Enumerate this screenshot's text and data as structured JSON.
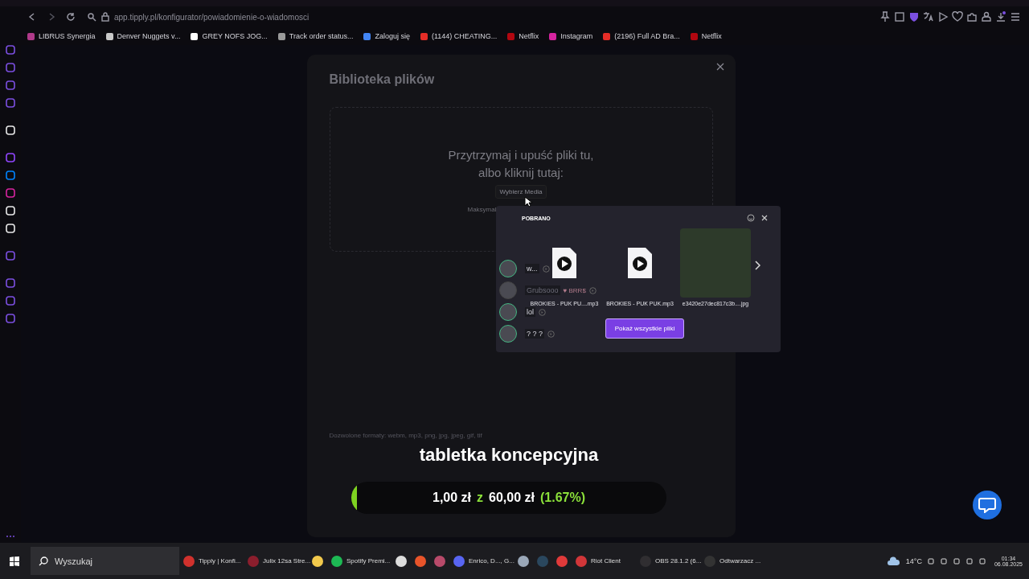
{
  "browser": {
    "address": "app.tipply.pl/konfigurator/powiadomienie-o-wiadomosci",
    "bookmarks": [
      {
        "label": "LIBRUS Synergia",
        "color": "#b03a8a"
      },
      {
        "label": "Denver Nuggets v...",
        "color": "#c9c9c9"
      },
      {
        "label": "GREY NOFS JOG...",
        "color": "#ffffff"
      },
      {
        "label": "Track order status...",
        "color": "#9a9a9a"
      },
      {
        "label": "Zaloguj się",
        "color": "#4285f4"
      },
      {
        "label": "(1144) CHEATING...",
        "color": "#e52d27"
      },
      {
        "label": "Netflix",
        "color": "#b20710"
      },
      {
        "label": "Instagram",
        "color": "#d6249f"
      },
      {
        "label": "(2196) Full AD Bra...",
        "color": "#e52d27"
      },
      {
        "label": "Netflix",
        "color": "#b20710"
      }
    ]
  },
  "modal": {
    "title": "Biblioteka plików",
    "dropzone": {
      "lines": [
        "Przytrzymaj i upuść pliki tu,",
        "albo kliknij tutaj:"
      ],
      "button": "Wybierz Media",
      "limit_note": "Maksymal"
    },
    "formats_note": "Dozwolone formaty: webm, mp3, png, jpg, jpeg, gif, tif"
  },
  "downloads_popup": {
    "title": "POBRANO",
    "files": [
      {
        "name": "BROKIES - PUK PU....mp3",
        "kind": "audio"
      },
      {
        "name": "BROKIES - PUK PUK.mp3",
        "kind": "audio"
      },
      {
        "name": "e3420e27dec817c3b....jpg",
        "kind": "image"
      }
    ],
    "button": "Pokaż wszystkie pliki"
  },
  "voice_overlay": {
    "users": [
      {
        "name": "w...",
        "speaking": true
      },
      {
        "name": "Grubsooo",
        "badge": "♥ BRR$",
        "speaking": false
      },
      {
        "name": "lol",
        "speaking": true
      },
      {
        "name": "? ? ?",
        "speaking": true
      }
    ]
  },
  "goal_overlay": {
    "title": "tabletka koncepcyjna",
    "raised": "1,00 zł",
    "separator": "z",
    "goal": "60,00 zł",
    "percent": "(1.67%)",
    "level": 0.0167
  },
  "taskbar": {
    "search": "Wyszukaj",
    "apps": [
      {
        "label": "Tipply | Konfi...",
        "color": "#d0312d"
      },
      {
        "label": "Julix 12sa Stre...",
        "color": "#8b1e2d"
      },
      {
        "color": "#f2c94c"
      },
      {
        "label": "Spotify Premi...",
        "color": "#1db954"
      },
      {
        "color": "#dddddd"
      },
      {
        "color": "#e8542a"
      },
      {
        "color": "#b84a6a"
      },
      {
        "label": "Enrico, D..., G...",
        "color": "#5865f2"
      },
      {
        "color": "#9aa7b8"
      },
      {
        "color": "#2a475e"
      },
      {
        "color": "#e03a3a"
      },
      {
        "label": "Riot Client",
        "color": "#d13639"
      },
      {
        "label": "OBS 28.1.2 (6...",
        "color": "#302e31"
      },
      {
        "label": "Odtwarzacz ...",
        "color": "#333333"
      }
    ],
    "weather": "14°C",
    "time": "01:34",
    "date": "06.08.2025"
  }
}
